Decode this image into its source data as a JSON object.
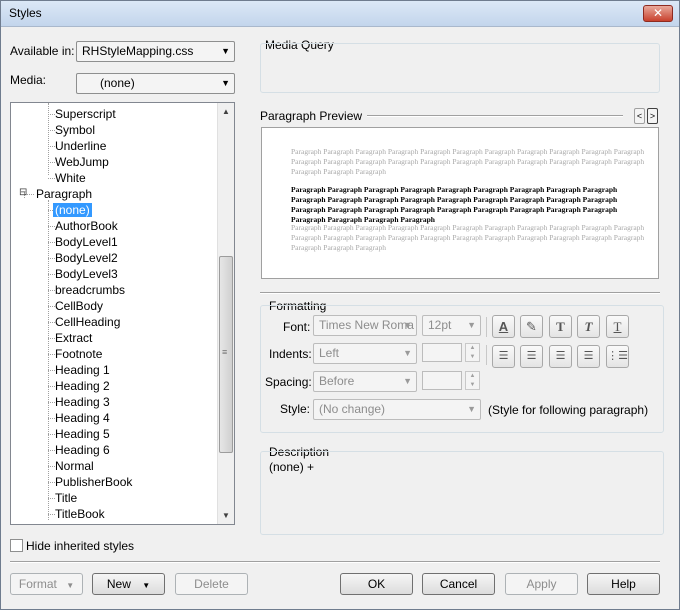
{
  "window": {
    "title": "Styles",
    "close_label": "✕"
  },
  "available_in": {
    "label": "Available in:",
    "value": "RHStyleMapping.css"
  },
  "media": {
    "label": "Media:",
    "value": "(none)"
  },
  "media_query": {
    "title": "Media Query"
  },
  "tree": {
    "items_top": [
      "Superscript",
      "Symbol",
      "Underline",
      "WebJump",
      "White"
    ],
    "parent": "Paragraph",
    "selected": "(none)",
    "children": [
      "AuthorBook",
      "BodyLevel1",
      "BodyLevel2",
      "BodyLevel3",
      "breadcrumbs",
      "CellBody",
      "CellHeading",
      "Extract",
      "Footnote",
      "Heading 1",
      "Heading 2",
      "Heading 3",
      "Heading 4",
      "Heading 5",
      "Heading 6",
      "Normal",
      "PublisherBook",
      "Title",
      "TitleBook"
    ]
  },
  "preview": {
    "title": "Paragraph Preview",
    "prev_icon": "chevron-left-icon",
    "next_icon": "chevron-right-icon",
    "gray_text_1": "Paragraph Paragraph Paragraph Paragraph Paragraph Paragraph Paragraph Paragraph Paragraph Paragraph Paragraph Paragraph Paragraph Paragraph Paragraph Paragraph Paragraph Paragraph Paragraph Paragraph Paragraph Paragraph Paragraph Paragraph Paragraph",
    "bold_text": "Paragraph Paragraph Paragraph Paragraph Paragraph Paragraph Paragraph Paragraph Paragraph Paragraph Paragraph Paragraph Paragraph Paragraph Paragraph Paragraph Paragraph Paragraph Paragraph Paragraph Paragraph Paragraph Paragraph Paragraph Paragraph Paragraph Paragraph Paragraph Paragraph Paragraph Paragraph",
    "gray_text_2": "Paragraph Paragraph Paragraph Paragraph Paragraph Paragraph Paragraph Paragraph Paragraph Paragraph Paragraph Paragraph Paragraph Paragraph Paragraph Paragraph Paragraph Paragraph Paragraph Paragraph Paragraph Paragraph Paragraph Paragraph Paragraph"
  },
  "formatting": {
    "title": "Formatting",
    "font_label": "Font:",
    "font_value": "Times New Roma",
    "size_value": "12pt",
    "indents_label": "Indents:",
    "indents_value": "Left",
    "spacing_label": "Spacing:",
    "spacing_value": "Before",
    "style_label": "Style:",
    "style_value": "(No change)",
    "style_note": "(Style for following paragraph)",
    "font_buttons": [
      "font-color-icon",
      "highlight-icon",
      "bold-icon",
      "italic-icon",
      "underline-icon"
    ],
    "align_buttons": [
      "align-left-icon",
      "align-center-icon",
      "align-right-icon",
      "justify-icon",
      "bullets-icon"
    ]
  },
  "description": {
    "title": "Description",
    "text": "(none) +"
  },
  "hide_inherited": {
    "label": "Hide inherited styles",
    "checked": false
  },
  "buttons": {
    "format": "Format",
    "new": "New",
    "delete": "Delete",
    "ok": "OK",
    "cancel": "Cancel",
    "apply": "Apply",
    "help": "Help"
  }
}
